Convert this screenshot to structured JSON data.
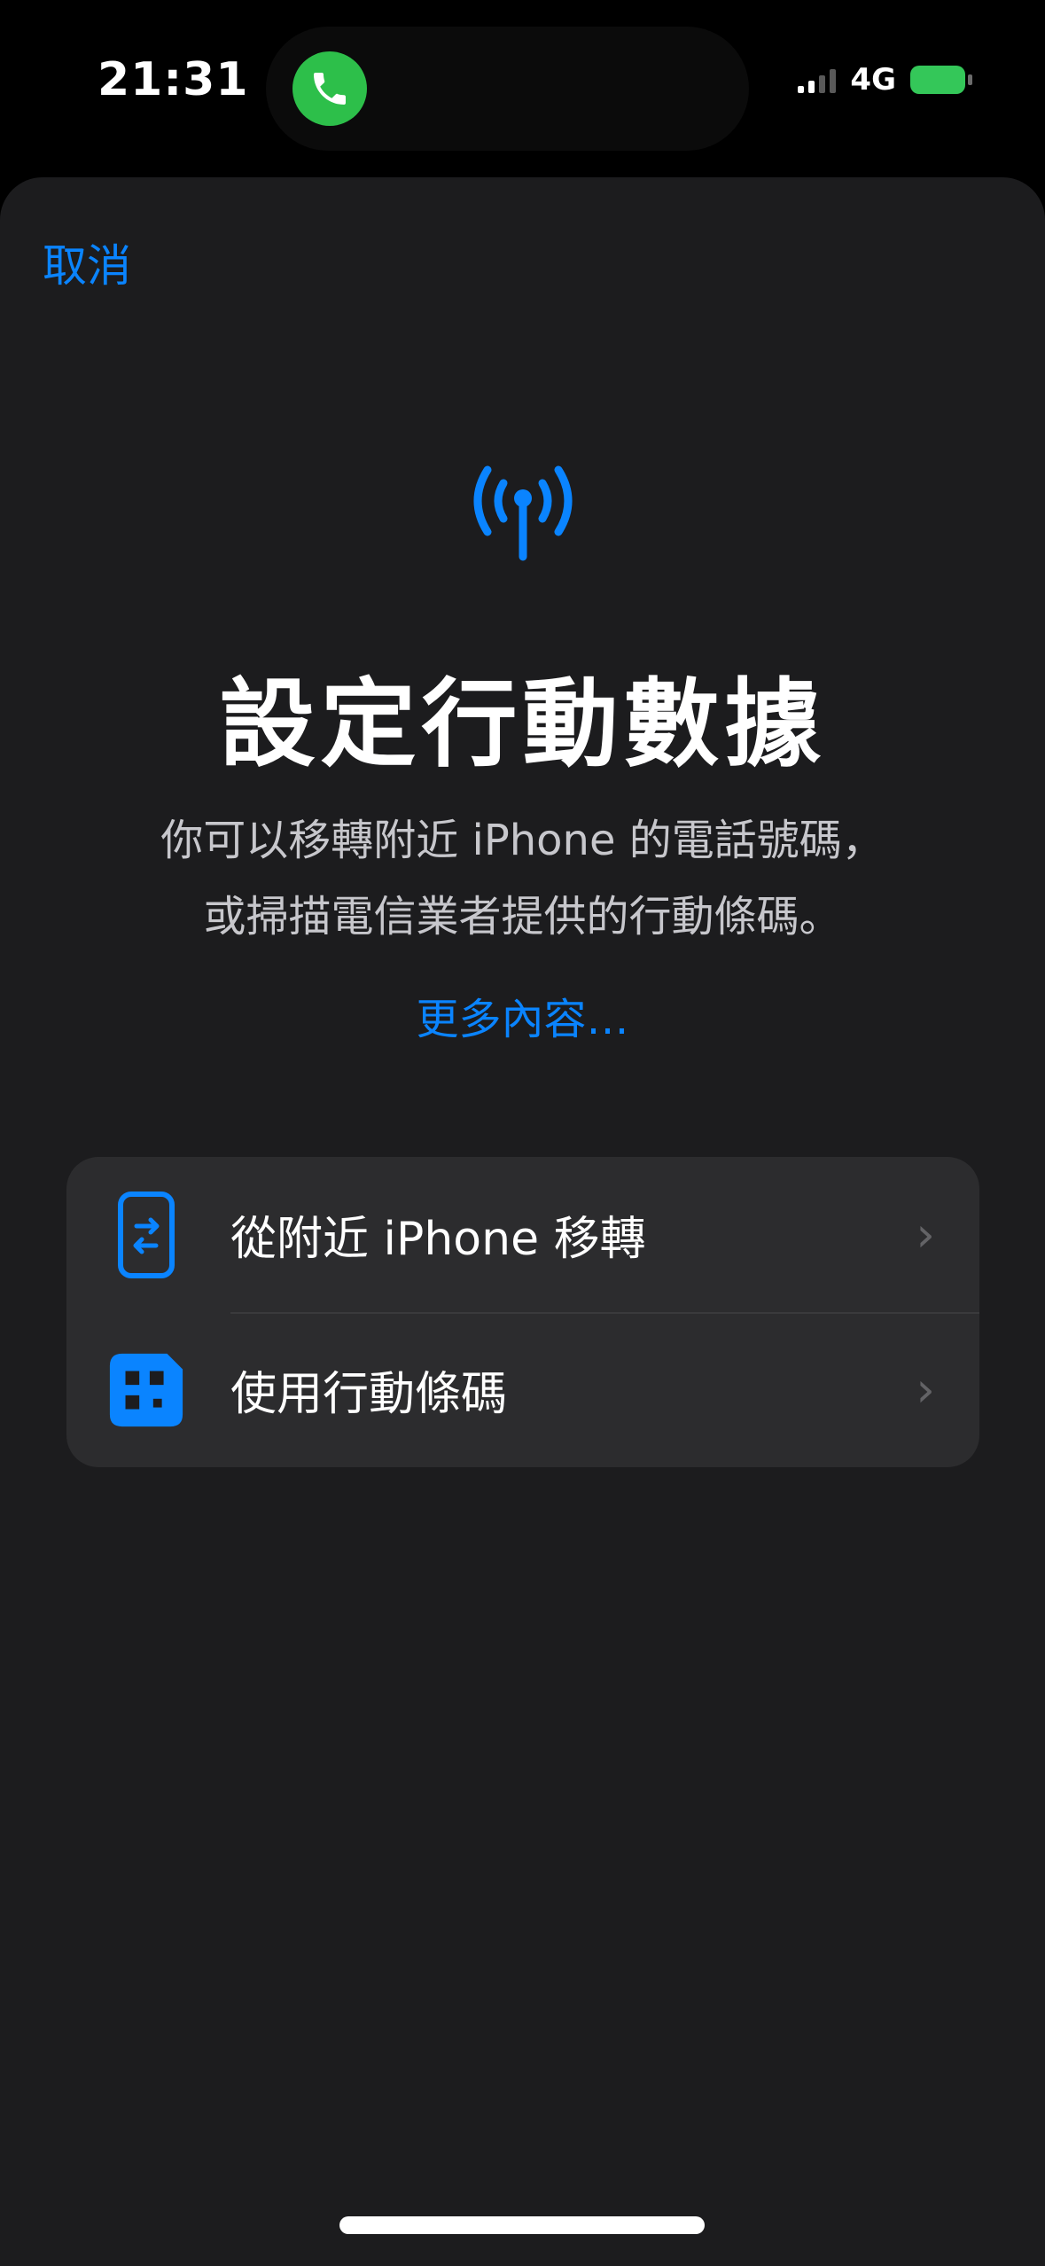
{
  "status_bar": {
    "time": "21:31",
    "network": "4G",
    "battery_color": "#34c759",
    "call_indicator_color": "#2dbf4a"
  },
  "sheet": {
    "cancel_label": "取消",
    "hero_icon": "cellular-antenna-icon",
    "title": "設定行動數據",
    "subtitle_line1": "你可以移轉附近 iPhone 的電話號碼，",
    "subtitle_line2": "或掃描電信業者提供的行動條碼。",
    "learn_more": "更多內容…",
    "accent_color": "#0a84ff"
  },
  "options": [
    {
      "label": "從附近 iPhone 移轉",
      "icon": "iphone-transfer-icon"
    },
    {
      "label": "使用行動條碼",
      "icon": "sim-qr-code-icon"
    }
  ]
}
